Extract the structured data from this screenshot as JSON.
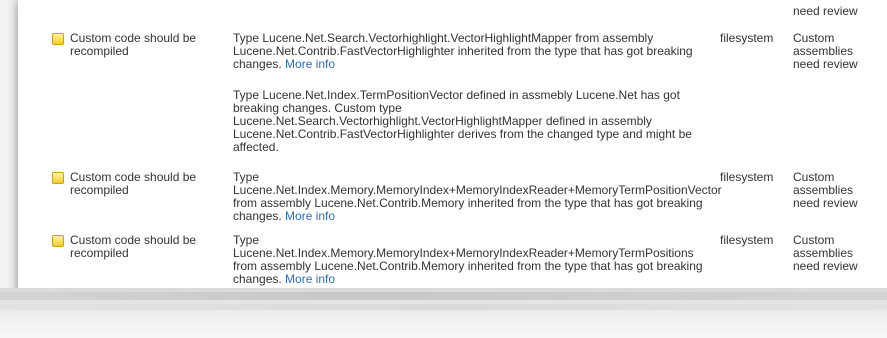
{
  "rows": [
    {
      "title": "",
      "description": "",
      "more": "",
      "location": "",
      "category": "need review"
    },
    {
      "title": "Custom code should be recompiled",
      "description": "Type Lucene.Net.Search.Vectorhighlight.VectorHighlightMapper from assembly Lucene.Net.Contrib.FastVectorHighlighter inherited from the type that has got breaking changes.",
      "more": "More info",
      "location": "filesystem",
      "category": "Custom assemblies need review"
    },
    {
      "title": "",
      "description": "Type Lucene.Net.Index.TermPositionVector defined in assmebly Lucene.Net has got breaking changes. Custom type Lucene.Net.Search.Vectorhighlight.VectorHighlightMapper defined in assembly Lucene.Net.Contrib.FastVectorHighlighter derives from the changed type and might be affected.",
      "more": "",
      "location": "",
      "category": ""
    },
    {
      "title": "Custom code should be recompiled",
      "description": "Type Lucene.Net.Index.Memory.MemoryIndex+MemoryIndexReader+MemoryTermPositionVector from assembly Lucene.Net.Contrib.Memory inherited from the type that has got breaking changes.",
      "more": "More info",
      "location": "filesystem",
      "category": "Custom assemblies need review"
    },
    {
      "title": "Custom code should be recompiled",
      "description": "Type Lucene.Net.Index.Memory.MemoryIndex+MemoryIndexReader+MemoryTermPositions from assembly Lucene.Net.Contrib.Memory inherited from the type that has got breaking changes.",
      "more": "More info",
      "location": "filesystem",
      "category": "Custom assemblies need review"
    }
  ],
  "icons": {
    "warning": "warning-icon"
  },
  "colors": {
    "link": "#2a6ebb",
    "icon": "#f3cc2f"
  }
}
